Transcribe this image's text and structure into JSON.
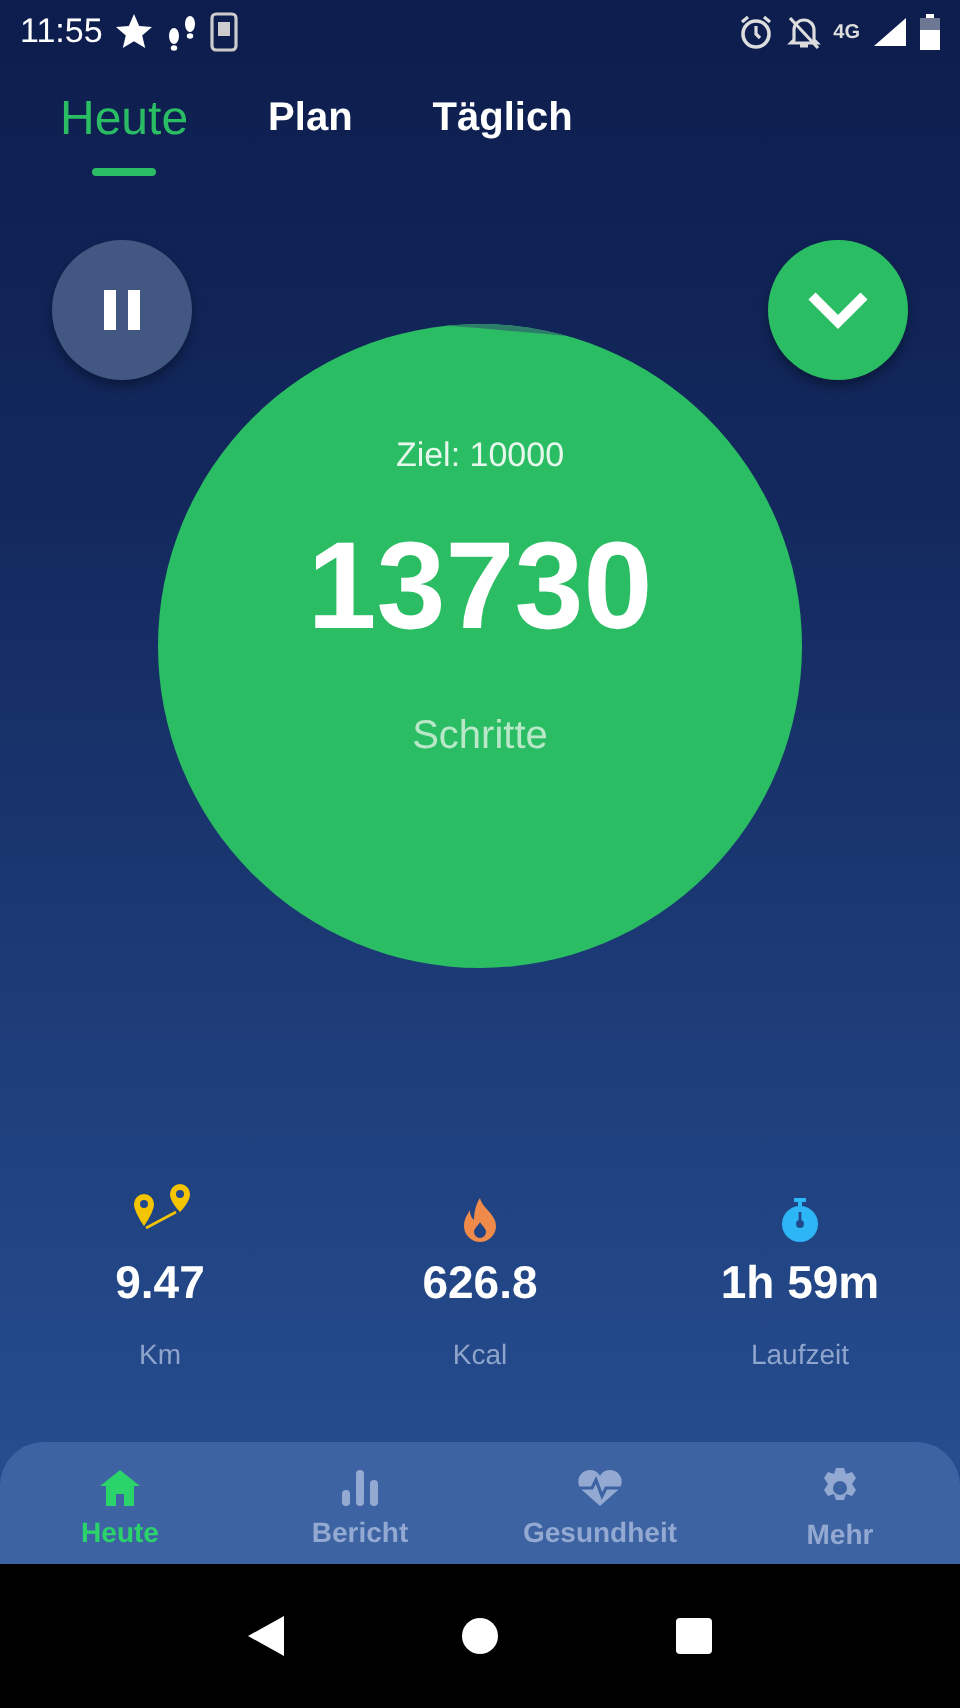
{
  "status_bar": {
    "time": "11:55",
    "network": "4G"
  },
  "tabs": [
    {
      "label": "Heute",
      "selected": true
    },
    {
      "label": "Plan",
      "selected": false
    },
    {
      "label": "Täglich",
      "selected": false
    }
  ],
  "steps": {
    "goal": "Ziel: 10000",
    "count": "13730",
    "unit": "Schritte"
  },
  "stats": [
    {
      "kind": "distance",
      "value": "9.47",
      "unit": "Km"
    },
    {
      "kind": "calories",
      "value": "626.8",
      "unit": "Kcal"
    },
    {
      "kind": "time",
      "value": "1h 59m",
      "unit": "Laufzeit"
    }
  ],
  "nav": [
    {
      "kind": "home",
      "label": "Heute",
      "selected": true
    },
    {
      "kind": "report",
      "label": "Bericht",
      "selected": false
    },
    {
      "kind": "health",
      "label": "Gesundheit",
      "selected": false
    },
    {
      "kind": "more",
      "label": "Mehr",
      "selected": false
    }
  ]
}
